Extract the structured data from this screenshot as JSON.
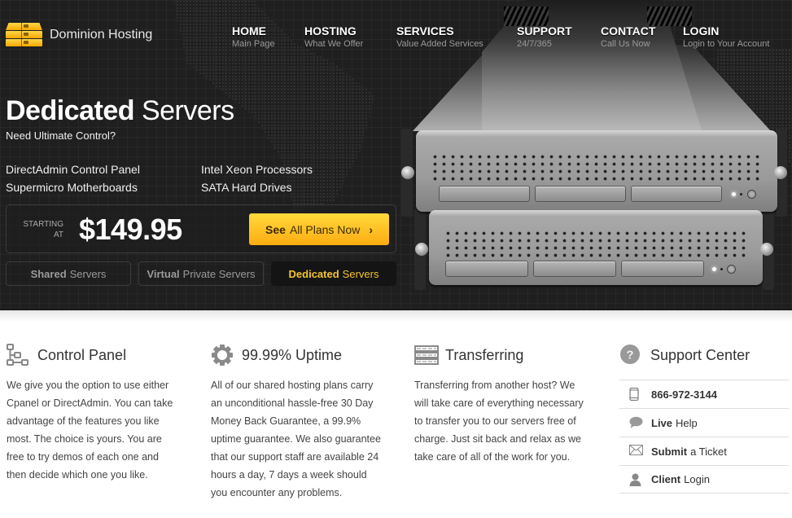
{
  "brand": {
    "name": "Dominion Hosting",
    "accent": "#ffc020"
  },
  "nav": [
    {
      "title": "HOME",
      "sub": "Main Page"
    },
    {
      "title": "HOSTING",
      "sub": "What We Offer"
    },
    {
      "title": "SERVICES",
      "sub": "Value Added Services"
    },
    {
      "title": "SUPPORT",
      "sub": "24/7/365"
    },
    {
      "title": "CONTACT",
      "sub": "Call Us Now"
    },
    {
      "title": "LOGIN",
      "sub": "Login to Your Account"
    }
  ],
  "hero": {
    "title_bold": "Dedicated",
    "title_rest": "Servers",
    "subtitle": "Need Ultimate Control?",
    "features": [
      "DirectAdmin Control Panel",
      "Intel Xeon Processors",
      "Supermicro Motherboards",
      "SATA Hard Drives"
    ],
    "starting_line1": "STARTING",
    "starting_line2": "AT",
    "price": "$149.95",
    "cta_bold": "See",
    "cta_rest": "All Plans Now",
    "cta_chevron": "›"
  },
  "tabs": [
    {
      "bold": "Shared",
      "rest": "Servers",
      "active": false
    },
    {
      "bold": "Virtual",
      "rest": "Private Servers",
      "active": false
    },
    {
      "bold": "Dedicated",
      "rest": "Servers",
      "active": true
    }
  ],
  "columns": [
    {
      "icon": "sitemap-icon",
      "title": "Control Panel",
      "body": "We give you the option to use either Cpanel or DirectAdmin. You can take advantage of the features you like most. The choice is yours. You are free to try demos of each one and then decide which one you like."
    },
    {
      "icon": "gear-icon",
      "title": "99.99% Uptime",
      "body": "All of our shared hosting plans carry an unconditional hassle-free 30 Day Money Back Guarantee, a 99.9% uptime guarantee. We also guarantee that our support staff are available 24 hours a day, 7 days a week should you encounter any problems."
    },
    {
      "icon": "server-rack-icon",
      "title": "Transferring",
      "body": "Transferring from another host? We will take care of everything necessary to transfer you to our servers free of charge. Just sit back and relax as we take care of all of the work for you."
    }
  ],
  "support": {
    "title": "Support Center",
    "items": [
      {
        "icon": "phone-icon",
        "bold": "866-972-3144",
        "rest": ""
      },
      {
        "icon": "chat-bubble-icon",
        "bold": "Live",
        "rest": "Help"
      },
      {
        "icon": "envelope-icon",
        "bold": "Submit",
        "rest": "a Ticket"
      },
      {
        "icon": "user-icon",
        "bold": "Client",
        "rest": "Login"
      }
    ]
  }
}
